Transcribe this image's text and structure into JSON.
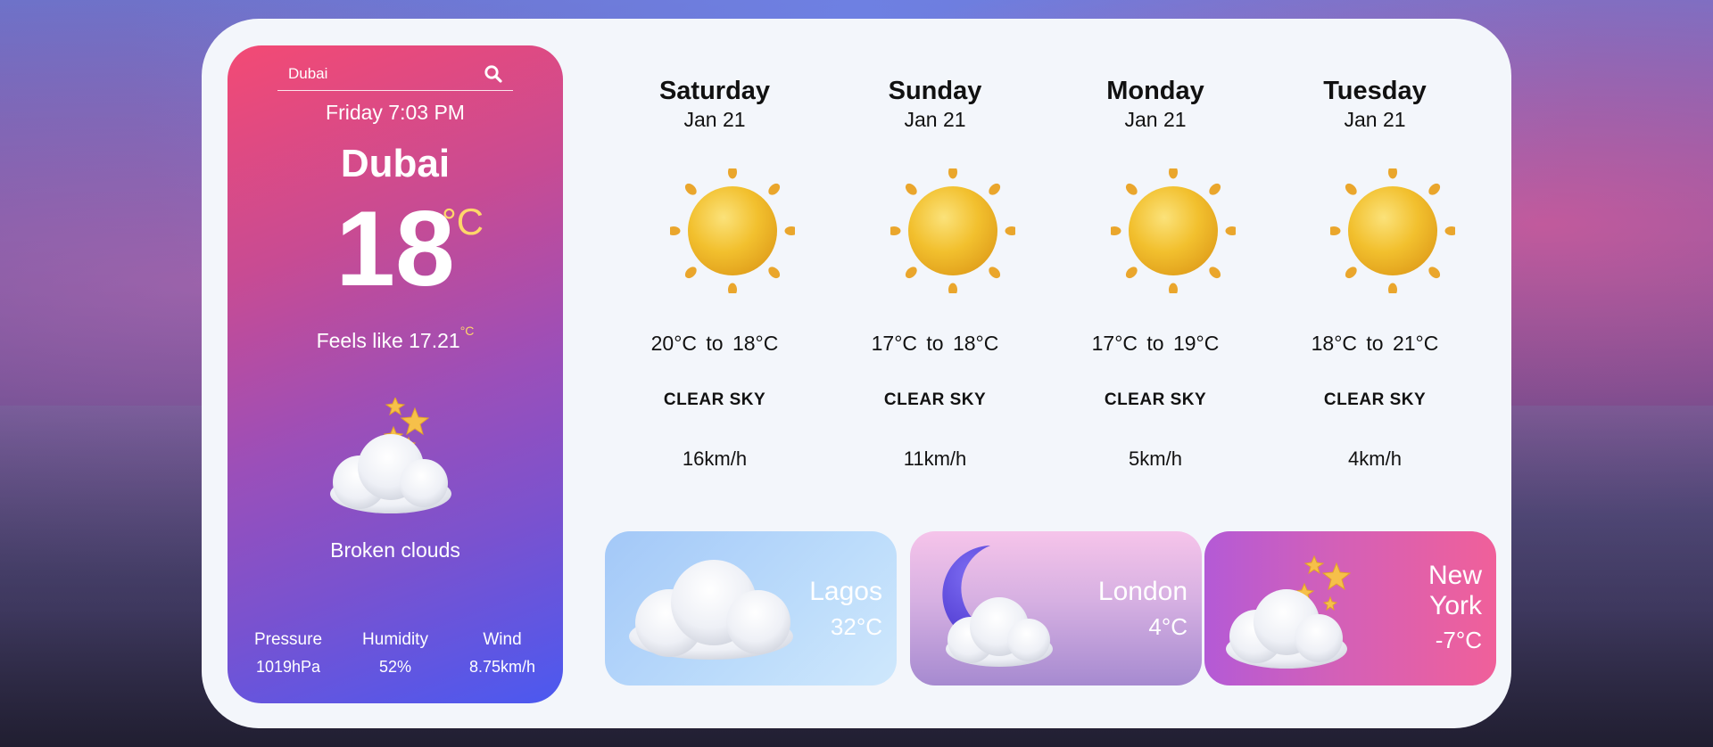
{
  "search": {
    "value": "Dubai",
    "placeholder": ""
  },
  "current": {
    "datetime": "Friday 7:03 PM",
    "city": "Dubai",
    "temperature": "18",
    "unit": "°C",
    "feels_like_label": "Feels like 17.21",
    "feels_like_unit": "°C",
    "description": "Broken clouds",
    "icon": "cloud-night-stars-icon",
    "stats": [
      {
        "label": "Pressure",
        "value": "1019hPa"
      },
      {
        "label": "Humidity",
        "value": "52%"
      },
      {
        "label": "Wind",
        "value": "8.75km/h"
      }
    ]
  },
  "forecast": [
    {
      "day": "Saturday",
      "date": "Jan 21",
      "range": "20°C  to  18°C",
      "condition": "CLEAR SKY",
      "wind": "16km/h",
      "icon": "sun-icon"
    },
    {
      "day": "Sunday",
      "date": "Jan 21",
      "range": "17°C  to  18°C",
      "condition": "CLEAR SKY",
      "wind": "11km/h",
      "icon": "sun-icon"
    },
    {
      "day": "Monday",
      "date": "Jan 21",
      "range": "17°C  to  19°C",
      "condition": "CLEAR SKY",
      "wind": "5km/h",
      "icon": "sun-icon"
    },
    {
      "day": "Tuesday",
      "date": "Jan 21",
      "range": "18°C  to  21°C",
      "condition": "CLEAR SKY",
      "wind": "4km/h",
      "icon": "sun-icon"
    }
  ],
  "cities": [
    {
      "name": "Lagos",
      "temp": "32°C",
      "icon": "cloud-icon"
    },
    {
      "name": "London",
      "temp": "4°C",
      "icon": "moon-cloud-icon"
    },
    {
      "name_line1": "New",
      "name_line2": "York",
      "temp": "-7°C",
      "icon": "cloud-stars-icon"
    }
  ],
  "colors": {
    "panel_bg": "#f3f6fb",
    "left_gradient_start": "#f34a74",
    "left_gradient_end": "#4b59f0",
    "accent_unit": "#ffd76a"
  }
}
